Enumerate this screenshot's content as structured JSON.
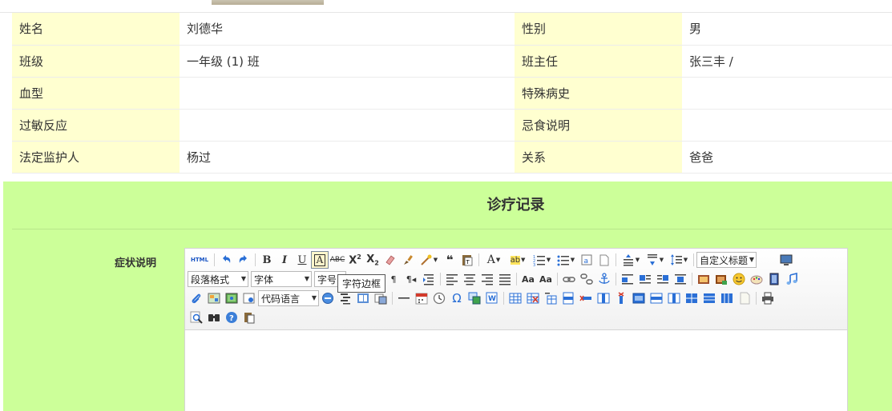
{
  "info": {
    "rows": [
      {
        "l1": "姓名",
        "v1": "刘德华",
        "l2": "性别",
        "v2": "男"
      },
      {
        "l1": "班级",
        "v1": "一年级 (1) 班",
        "l2": "班主任",
        "v2": "张三丰 /"
      },
      {
        "l1": "血型",
        "v1": "",
        "l2": "特殊病史",
        "v2": ""
      },
      {
        "l1": "过敏反应",
        "v1": "",
        "l2": "忌食说明",
        "v2": ""
      },
      {
        "l1": "法定监护人",
        "v1": "杨过",
        "l2": "关系",
        "v2": "爸爸"
      }
    ]
  },
  "section": {
    "title": "诊疗记录",
    "field_label": "症状说明"
  },
  "editor": {
    "html_label": "HTML",
    "custom_title_select": "自定义标题",
    "paragraph_select": "段落格式",
    "font_select": "字体",
    "size_select": "字号",
    "code_lang_select": "代码语言",
    "tooltip": "字符边框",
    "colors": {
      "accent_blue": "#2a6fd6",
      "icon_red": "#d33b2c",
      "icon_green": "#3fa34d"
    }
  },
  "colors": {
    "label_bg": "#ffffd0",
    "section_bg": "#ccff99"
  }
}
